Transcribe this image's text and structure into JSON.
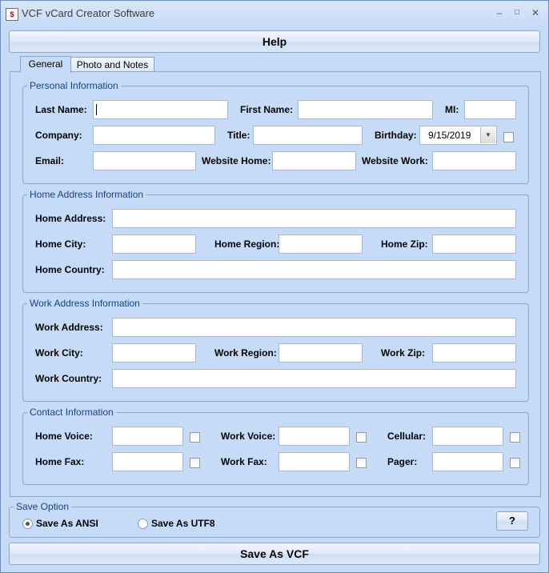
{
  "window": {
    "title": "VCF vCard Creator Software",
    "app_icon": "vcard-app-icon"
  },
  "toolbar": {
    "help_label": "Help",
    "save_label": "Save As VCF"
  },
  "tabs": [
    {
      "label": "General",
      "active": true
    },
    {
      "label": "Photo and Notes",
      "active": false
    }
  ],
  "personal": {
    "title": "Personal Information",
    "last_name_label": "Last Name:",
    "first_name_label": "First Name:",
    "mi_label": "MI:",
    "company_label": "Company:",
    "title_label": "Title:",
    "birthday_label": "Birthday:",
    "birthday_value": "9/15/2019",
    "birthday_checked": false,
    "email_label": "Email:",
    "website_home_label": "Website Home:",
    "website_work_label": "Website Work:"
  },
  "home": {
    "title": "Home Address Information",
    "address_label": "Home Address:",
    "city_label": "Home City:",
    "region_label": "Home Region:",
    "zip_label": "Home Zip:",
    "country_label": "Home Country:"
  },
  "work": {
    "title": "Work Address Information",
    "address_label": "Work Address:",
    "city_label": "Work City:",
    "region_label": "Work Region:",
    "zip_label": "Work Zip:",
    "country_label": "Work Country:"
  },
  "contact": {
    "title": "Contact Information",
    "home_voice_label": "Home Voice:",
    "work_voice_label": "Work Voice:",
    "cellular_label": "Cellular:",
    "home_fax_label": "Home Fax:",
    "work_fax_label": "Work Fax:",
    "pager_label": "Pager:"
  },
  "save_option": {
    "title": "Save Option",
    "ansi_label": "Save As ANSI",
    "utf8_label": "Save As UTF8",
    "selected": "ansi",
    "help_q_label": "?"
  }
}
